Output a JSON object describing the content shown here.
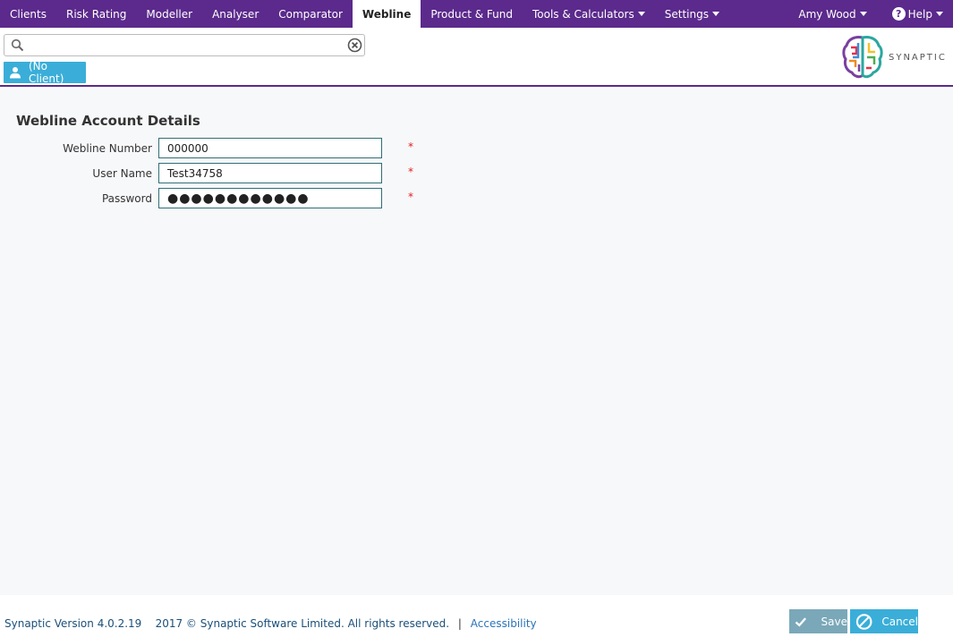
{
  "nav": {
    "items": [
      {
        "label": "Clients"
      },
      {
        "label": "Risk Rating"
      },
      {
        "label": "Modeller"
      },
      {
        "label": "Analyser"
      },
      {
        "label": "Comparator"
      },
      {
        "label": "Webline"
      },
      {
        "label": "Product & Fund"
      },
      {
        "label": "Tools & Calculators"
      },
      {
        "label": "Settings"
      }
    ],
    "user": "Amy Wood",
    "help": "Help"
  },
  "header": {
    "search_value": "",
    "client_label": "(No Client)",
    "logo_text": "SYNAPTIC"
  },
  "page": {
    "title": "Webline Account Details",
    "fields": [
      {
        "label": "Webline Number",
        "value": "000000",
        "required": "*"
      },
      {
        "label": "User Name",
        "value": "Test34758",
        "required": "*"
      },
      {
        "label": "Password",
        "value": "●●●●●●●●●●●●",
        "required": "*"
      }
    ]
  },
  "footer": {
    "version": "Synaptic Version 4.0.2.19",
    "copyright": "2017 © Synaptic Software Limited. All rights reserved.",
    "separator": "|",
    "accessibility": "Accessibility",
    "save_label": "Save",
    "cancel_label": "Cancel"
  },
  "colors": {
    "nav_bg": "#5b2a8c",
    "accent": "#3aaed8",
    "save_bg": "#7aa8b8",
    "required": "#e02020"
  }
}
